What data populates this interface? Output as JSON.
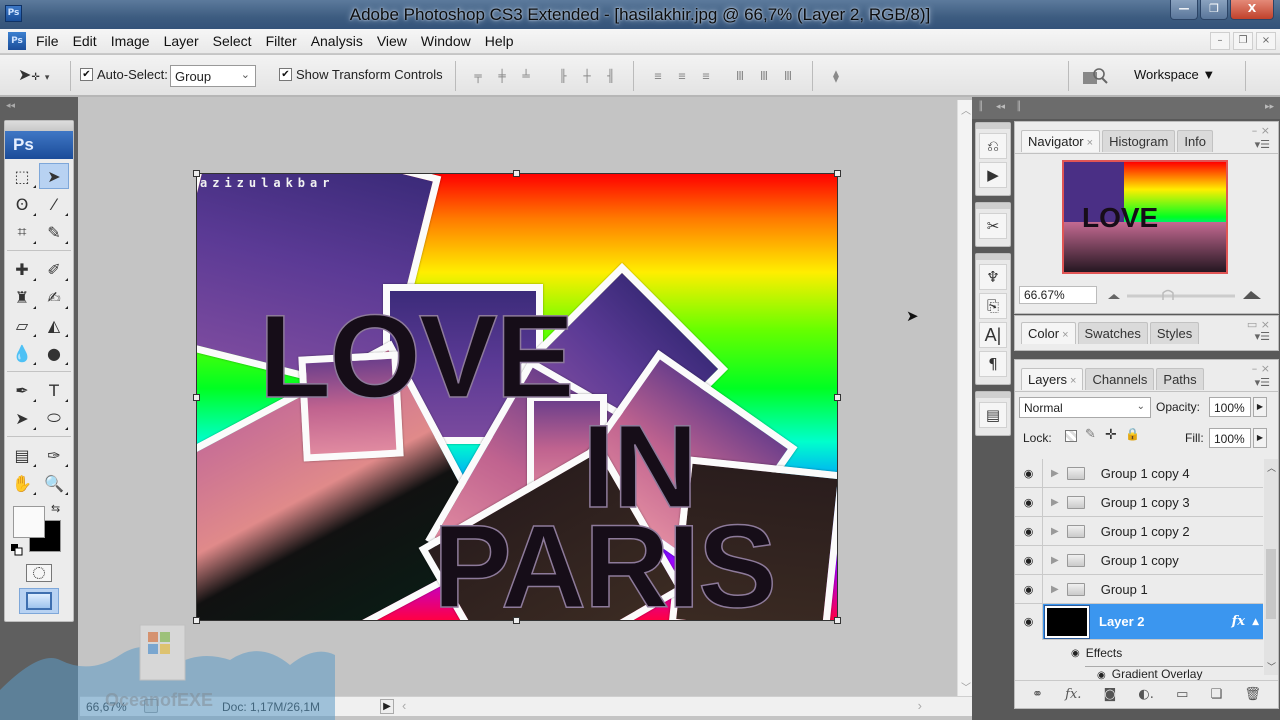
{
  "titlebar": {
    "title": "Adobe Photoshop CS3 Extended - [hasilakhir.jpg @ 66,7% (Layer 2, RGB/8)]",
    "app_icon": "Ps",
    "minimize": "—",
    "maximize": "❐",
    "close": "X"
  },
  "menubar": {
    "items": [
      "File",
      "Edit",
      "Image",
      "Layer",
      "Select",
      "Filter",
      "Analysis",
      "View",
      "Window",
      "Help"
    ],
    "doc_controls": [
      "–",
      "❐",
      "×"
    ]
  },
  "options_bar": {
    "tool_icon": "move-tool-icon",
    "auto_select_label": "Auto-Select:",
    "auto_select_checked": true,
    "auto_select_value": "Group",
    "show_transform_label": "Show Transform Controls",
    "show_transform_checked": true,
    "align_icons": [
      "align-top-icon",
      "align-vcenter-icon",
      "align-bottom-icon",
      "align-left-icon",
      "align-hcenter-icon",
      "align-right-icon"
    ],
    "distribute_icons": [
      "distribute-top-icon",
      "distribute-vcenter-icon",
      "distribute-bottom-icon",
      "distribute-left-icon",
      "distribute-hcenter-icon",
      "distribute-right-icon"
    ],
    "auto_align_icon": "auto-align-icon",
    "workspace_label": "Workspace ▼"
  },
  "toolbox": {
    "badge": "Ps",
    "tools": [
      {
        "name": "marquee-tool",
        "glyph": "⬚"
      },
      {
        "name": "move-tool",
        "glyph": "➤",
        "active": true
      },
      {
        "name": "lasso-tool",
        "glyph": "ʘ"
      },
      {
        "name": "magic-wand-tool",
        "glyph": "⁄"
      },
      {
        "name": "crop-tool",
        "glyph": "⌗"
      },
      {
        "name": "slice-tool",
        "glyph": "✎"
      },
      {
        "name": "healing-brush-tool",
        "glyph": "✚"
      },
      {
        "name": "brush-tool",
        "glyph": "✐"
      },
      {
        "name": "clone-stamp-tool",
        "glyph": "♜"
      },
      {
        "name": "history-brush-tool",
        "glyph": "✍"
      },
      {
        "name": "eraser-tool",
        "glyph": "▱"
      },
      {
        "name": "paint-bucket-tool",
        "glyph": "◭"
      },
      {
        "name": "blur-tool",
        "glyph": "💧"
      },
      {
        "name": "dodge-tool",
        "glyph": "●"
      },
      {
        "name": "pen-tool",
        "glyph": "✒"
      },
      {
        "name": "type-tool",
        "glyph": "T"
      },
      {
        "name": "path-selection-tool",
        "glyph": "➤"
      },
      {
        "name": "ellipse-tool",
        "glyph": "⬭"
      },
      {
        "name": "notes-tool",
        "glyph": "▤"
      },
      {
        "name": "eyedropper-tool",
        "glyph": "✑"
      },
      {
        "name": "hand-tool",
        "glyph": "✋"
      },
      {
        "name": "zoom-tool",
        "glyph": "🔍"
      }
    ],
    "foreground_color": "#fafafa",
    "background_color": "#000000"
  },
  "document": {
    "watermark_text": "azizulakbar",
    "canvas_words": [
      "LOVE",
      "IN",
      "PARIS"
    ],
    "status_zoom": "66,67%",
    "status_doc": "Doc: 1,17M/26,1M"
  },
  "navigator_panel": {
    "tabs": [
      "Navigator",
      "Histogram",
      "Info"
    ],
    "active_tab": "Navigator",
    "zoom_value": "66.67%"
  },
  "color_panel": {
    "tabs": [
      "Color",
      "Swatches",
      "Styles"
    ],
    "active_tab": "Color"
  },
  "layers_panel": {
    "tabs": [
      "Layers",
      "Channels",
      "Paths"
    ],
    "active_tab": "Layers",
    "blend_mode": "Normal",
    "opacity_label": "Opacity:",
    "opacity_value": "100%",
    "lock_label": "Lock:",
    "fill_label": "Fill:",
    "fill_value": "100%",
    "layers": [
      {
        "name": "Group 1 copy 4",
        "type": "group",
        "visible": true
      },
      {
        "name": "Group 1 copy 3",
        "type": "group",
        "visible": true
      },
      {
        "name": "Group 1 copy 2",
        "type": "group",
        "visible": true
      },
      {
        "name": "Group 1 copy",
        "type": "group",
        "visible": true
      },
      {
        "name": "Group 1",
        "type": "group",
        "visible": true
      },
      {
        "name": "Layer 2",
        "type": "layer",
        "visible": true,
        "selected": true,
        "fx": "fx"
      }
    ],
    "effects_label": "Effects",
    "effect_items": [
      "Gradient Overlay"
    ],
    "footer_icons": [
      "link-layers-icon",
      "add-style-icon",
      "add-mask-icon",
      "adjustment-layer-icon",
      "new-group-icon",
      "new-layer-icon",
      "delete-layer-icon"
    ]
  },
  "watermark": {
    "text": "OceanofEXE"
  }
}
